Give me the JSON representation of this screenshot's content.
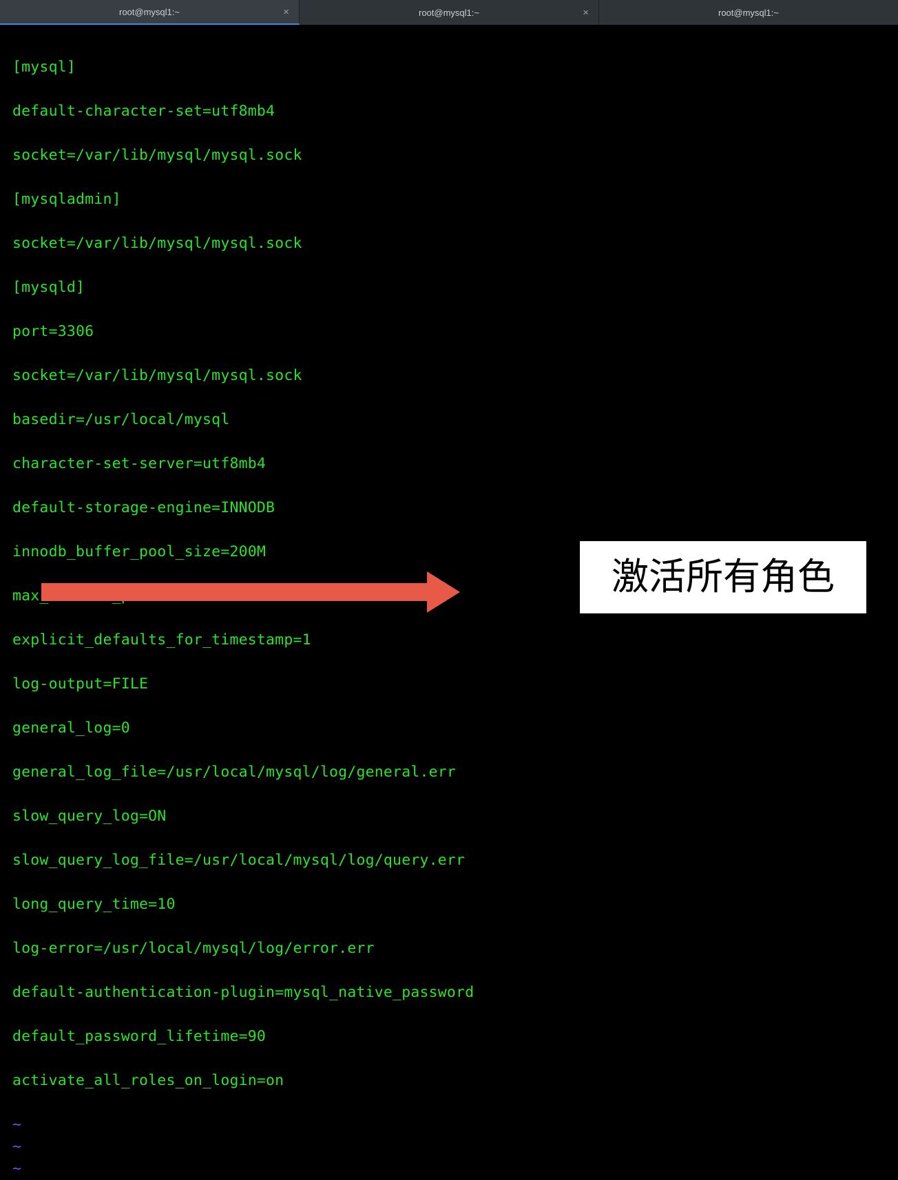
{
  "tabs": [
    {
      "title": "root@mysql1:~",
      "active": true,
      "closable": true
    },
    {
      "title": "root@mysql1:~",
      "active": false,
      "closable": true
    },
    {
      "title": "root@mysql1:~",
      "active": false,
      "closable": false
    }
  ],
  "close_glyph": "×",
  "config_lines": [
    "[mysql]",
    "default-character-set=utf8mb4",
    "socket=/var/lib/mysql/mysql.sock",
    "[mysqladmin]",
    "socket=/var/lib/mysql/mysql.sock",
    "[mysqld]",
    "port=3306",
    "socket=/var/lib/mysql/mysql.sock",
    "basedir=/usr/local/mysql",
    "character-set-server=utf8mb4",
    "default-storage-engine=INNODB",
    "innodb_buffer_pool_size=200M",
    "max_allowed_packet=16M",
    "explicit_defaults_for_timestamp=1",
    "log-output=FILE",
    "general_log=0",
    "general_log_file=/usr/local/mysql/log/general.err",
    "slow_query_log=ON",
    "slow_query_log_file=/usr/local/mysql/log/query.err",
    "long_query_time=10",
    "log-error=/usr/local/mysql/log/error.err",
    "default-authentication-plugin=mysql_native_password",
    "default_password_lifetime=90",
    "activate_all_roles_on_login=on"
  ],
  "tilde": "~",
  "annotation_text": "激活所有角色"
}
